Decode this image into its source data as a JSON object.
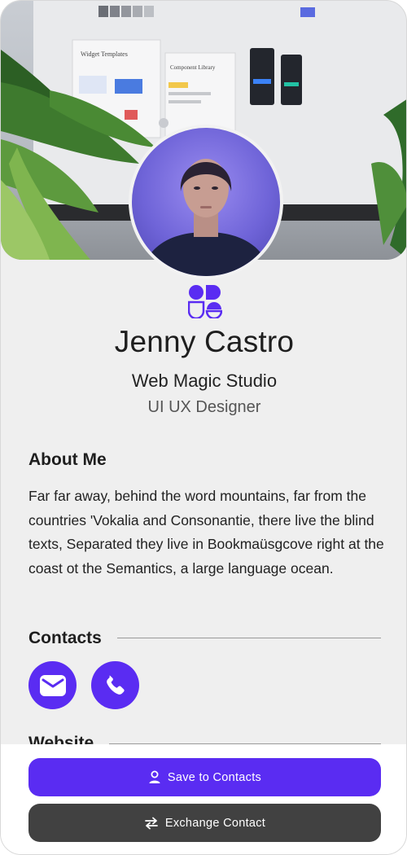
{
  "profile": {
    "name": "Jenny Castro",
    "company": "Web Magic Studio",
    "role": "UI UX Designer"
  },
  "hero": {
    "screen_panels": [
      "Widget Templates",
      "Component Library"
    ]
  },
  "about": {
    "title": "About Me",
    "text": "Far far away, behind the word mountains, far from the countries 'Vokalia and Consonantie, there live the blind texts, Separated they live in Bookmaüsgcove right at the coast ot the Semantics, a large language ocean."
  },
  "contacts": {
    "title": "Contacts",
    "items": [
      {
        "icon": "mail-icon"
      },
      {
        "icon": "phone-icon"
      }
    ]
  },
  "website": {
    "title": "Website"
  },
  "actions": {
    "save_label": "Save to Contacts",
    "exchange_label": "Exchange Contact"
  },
  "colors": {
    "accent": "#5a2cf2",
    "secondary_button": "#414141",
    "background": "#efefef"
  }
}
